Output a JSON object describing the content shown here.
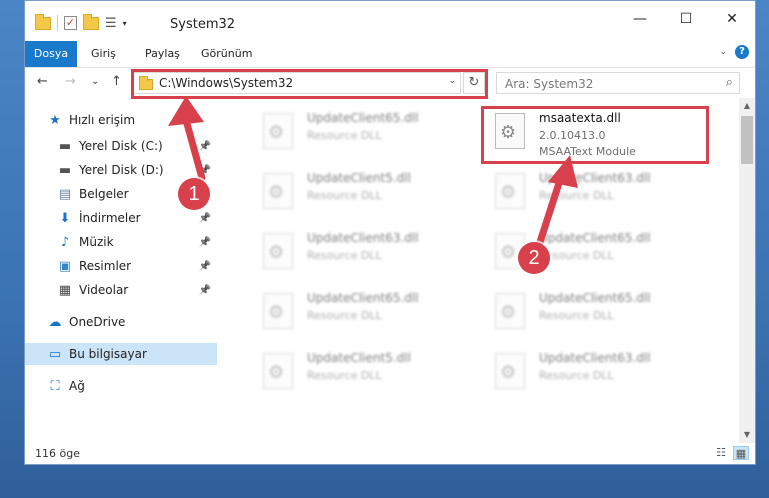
{
  "window": {
    "title": "System32",
    "controls": {
      "minimize": "—",
      "maximize": "☐",
      "close": "✕"
    },
    "qat_dropdown": "▾"
  },
  "ribbon": {
    "tabs": [
      "Dosya",
      "Giriş",
      "Paylaş",
      "Görünüm"
    ],
    "collapse_glyph": "⌄",
    "help_glyph": "?"
  },
  "navbar": {
    "back_glyph": "←",
    "forward_glyph": "→",
    "recent_glyph": "⌄",
    "up_glyph": "↑",
    "address": "C:\\Windows\\System32",
    "address_dropdown": "⌄",
    "refresh_glyph": "↻",
    "search_placeholder": "Ara: System32",
    "search_glyph": "⌕"
  },
  "nav_pane": {
    "pin_glyph": "📌",
    "items": [
      {
        "label": "Hızlı erişim",
        "icon": "star-icon",
        "glyph": "★",
        "color": "#1a73c8",
        "pinned": false
      },
      {
        "label": "Yerel Disk (C:)",
        "icon": "drive-icon",
        "glyph": "▬",
        "color": "#555555",
        "pinned": true
      },
      {
        "label": "Yerel Disk (D:)",
        "icon": "drive-icon",
        "glyph": "▬",
        "color": "#555555",
        "pinned": true
      },
      {
        "label": "Belgeler",
        "icon": "documents-icon",
        "glyph": "▤",
        "color": "#6a7fa8",
        "pinned": true
      },
      {
        "label": "İndirmeler",
        "icon": "downloads-icon",
        "glyph": "⬇",
        "color": "#1a73c8",
        "pinned": true
      },
      {
        "label": "Müzik",
        "icon": "music-icon",
        "glyph": "♪",
        "color": "#1a73c8",
        "pinned": true
      },
      {
        "label": "Resimler",
        "icon": "pictures-icon",
        "glyph": "▣",
        "color": "#3a87c4",
        "pinned": true
      },
      {
        "label": "Videolar",
        "icon": "videos-icon",
        "glyph": "▦",
        "color": "#444444",
        "pinned": true
      },
      {
        "label": "OneDrive",
        "icon": "onedrive-icon",
        "glyph": "☁",
        "color": "#1a73c8",
        "pinned": false
      },
      {
        "label": "Bu bilgisayar",
        "icon": "computer-icon",
        "glyph": "▭",
        "color": "#1a73c8",
        "pinned": false,
        "selected": true
      },
      {
        "label": "Ağ",
        "icon": "network-icon",
        "glyph": "⛶",
        "color": "#1a73c8",
        "pinned": false
      }
    ]
  },
  "files": [
    {
      "name": "UpdateClient65.dll",
      "line1": "Resource DLL",
      "line2": "",
      "blurred": true
    },
    {
      "name": "msaatexta.dll",
      "line1": "2.0.10413.0",
      "line2": "MSAAText Module",
      "blurred": false
    },
    {
      "name": "UpdateClient5.dll",
      "line1": "Resource DLL",
      "line2": "",
      "blurred": true
    },
    {
      "name": "UpdateClient63.dll",
      "line1": "Resource DLL",
      "line2": "",
      "blurred": true
    },
    {
      "name": "UpdateClient63.dll",
      "line1": "Resource DLL",
      "line2": "",
      "blurred": true
    },
    {
      "name": "UpdateClient65.dll",
      "line1": "Resource DLL",
      "line2": "",
      "blurred": true
    },
    {
      "name": "UpdateClient65.dll",
      "line1": "Resource DLL",
      "line2": "",
      "blurred": true
    },
    {
      "name": "UpdateClient65.dll",
      "line1": "Resource DLL",
      "line2": "",
      "blurred": true
    },
    {
      "name": "UpdateClient5.dll",
      "line1": "Resource DLL",
      "line2": "",
      "blurred": true
    },
    {
      "name": "UpdateClient63.dll",
      "line1": "Resource DLL",
      "line2": "",
      "blurred": true
    }
  ],
  "scrollbar": {
    "up": "▲",
    "down": "▼"
  },
  "status": {
    "item_count": "116 öge",
    "view_details_glyph": "☷",
    "view_tiles_glyph": "▦"
  },
  "annotations": {
    "badges": [
      "1",
      "2"
    ],
    "color": "#d8414b"
  }
}
